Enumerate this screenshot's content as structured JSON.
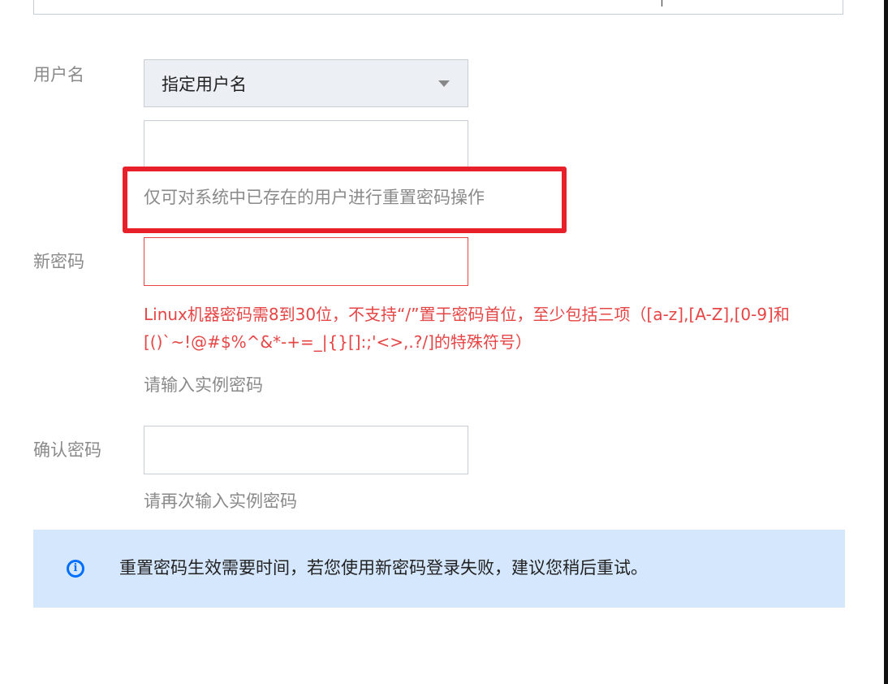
{
  "form": {
    "username": {
      "label": "用户名",
      "selected": "指定用户名",
      "input_value": "",
      "hint": "仅可对系统中已存在的用户进行重置密码操作"
    },
    "new_password": {
      "label": "新密码",
      "value": "",
      "error": "Linux机器密码需8到30位，不支持“/”置于密码首位，至少包括三项（[a-z],[A-Z],[0-9]和[()`~!@#$%^&*-+=_|{}[]:;'<>,.?/]的特殊符号）",
      "hint": "请输入实例密码"
    },
    "confirm_password": {
      "label": "确认密码",
      "value": "",
      "hint": "请再次输入实例密码"
    }
  },
  "notice": {
    "icon": "info-icon",
    "text": "重置密码生效需要时间，若您使用新密码登录失败，建议您稍后重试。"
  },
  "colors": {
    "error": "#e54545",
    "highlight": "#e8202a",
    "notice_bg": "#d5e7fd",
    "info_blue": "#006eff"
  }
}
